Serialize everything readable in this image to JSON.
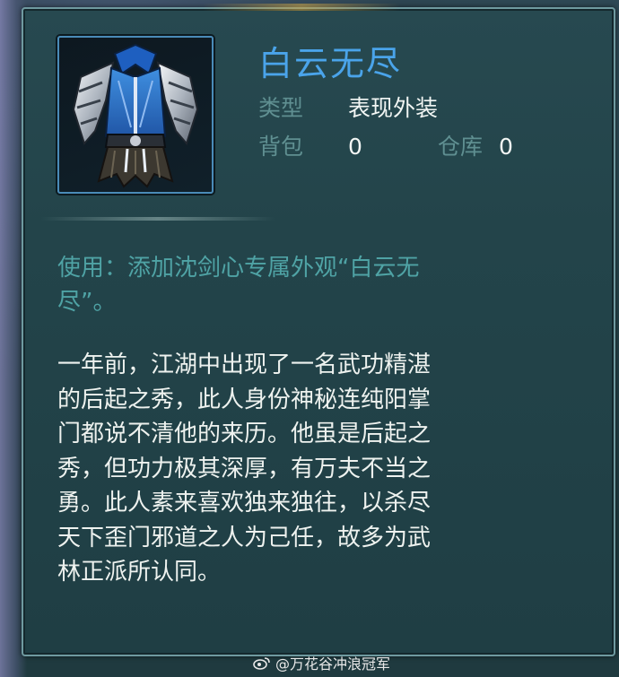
{
  "item": {
    "name": "白云无尽",
    "type_label": "类型",
    "type_value": "表现外装",
    "bag_label": "背包",
    "bag_value": "0",
    "warehouse_label": "仓库",
    "warehouse_value": "0",
    "icon": "armor-costume-icon"
  },
  "usage": [
    "使用：添加沈剑心专属外观“白云无",
    "尽”。"
  ],
  "lore": [
    "一年前，江湖中出现了一名武功精湛",
    "的后起之秀，此人身份神秘连纯阳掌",
    "门都说不清他的来历。他虽是后起之",
    "秀，但功力极其深厚，有万夫不当之",
    "勇。此人素来喜欢独来独往，以杀尽",
    "天下歪门邪道之人为己任，故多为武",
    "林正派所认同。"
  ],
  "watermark": "@万花谷冲浪冠军",
  "colors": {
    "name": "#4aa4ea",
    "label": "#5f8f91",
    "value": "#f2f6f4",
    "usage": "#4fa3a5",
    "lore": "#eef2ef",
    "panel_border": "#6f9aa0"
  }
}
